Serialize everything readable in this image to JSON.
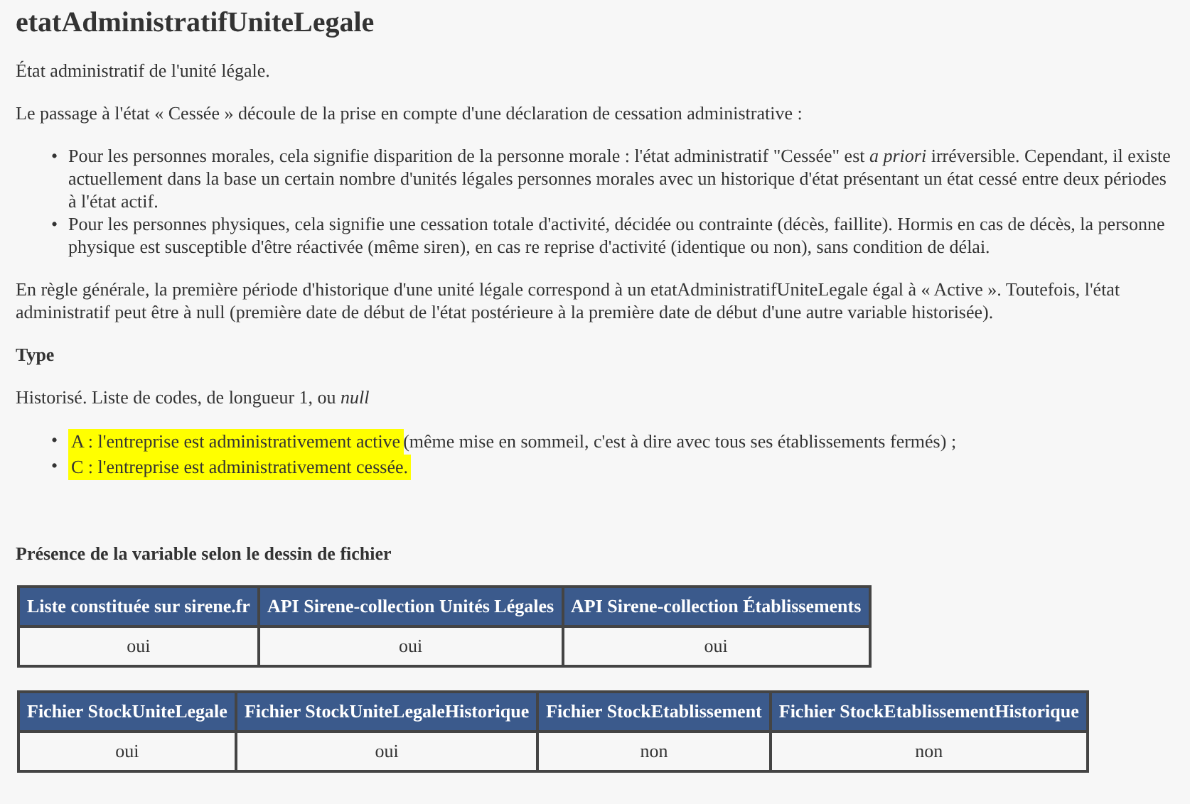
{
  "title": "etatAdministratifUniteLegale",
  "description": "État administratif de l'unité légale.",
  "intro": "Le passage à l'état « Cessée » découle de la prise en compte d'une déclaration de cessation administrative :",
  "cases": [
    "Pour les personnes morales, cela signifie disparition de la personne morale : l'état administratif \"Cessée\" est *a priori* irréversible. Cependant, il existe actuellement dans la base un certain nombre d'unités légales personnes morales avec un historique d'état présentant un état cessé entre deux périodes à l'état actif.",
    "Pour les personnes physiques, cela signifie une cessation totale d'activité, décidée ou contrainte (décès, faillite). Hormis en cas de décès, la personne physique est susceptible d'être réactivée (même siren), en cas re reprise d'activité (identique ou non), sans condition de délai."
  ],
  "note": "En règle générale, la première période d'historique d'une unité légale correspond à un etatAdministratifUniteLegale égal à « Active ». Toutefois, l'état administratif peut être à null (première date de début de l'état postérieure à la première date de début d'une autre variable historisée).",
  "type_heading": "Type",
  "type_text": "Historisé. Liste de codes, de longueur 1, ou *null*",
  "bullet": "•",
  "codes": [
    {
      "highlighted_text": "A : l'entreprise est administrativement active ",
      "text": "(même mise en sommeil, c'est à dire avec tous ses établissements fermés) ;"
    },
    {
      "highlighted_text": "C : l'entreprise est administrativement cessée."
    }
  ],
  "presence_heading": "Présence de la variable selon le dessin de fichier",
  "tables": [
    {
      "columns": [
        "Liste constituée sur sirene.fr",
        "API Sirene-collection Unités Légales",
        "API Sirene-collection Établissements"
      ],
      "rows": [
        [
          "oui",
          "oui",
          "oui"
        ]
      ]
    },
    {
      "columns": [
        "Fichier StockUniteLegale",
        "Fichier StockUniteLegaleHistorique",
        "Fichier StockEtablissement",
        "Fichier StockEtablissementHistorique"
      ],
      "rows": [
        [
          "oui",
          "oui",
          "non",
          "non"
        ]
      ]
    }
  ]
}
